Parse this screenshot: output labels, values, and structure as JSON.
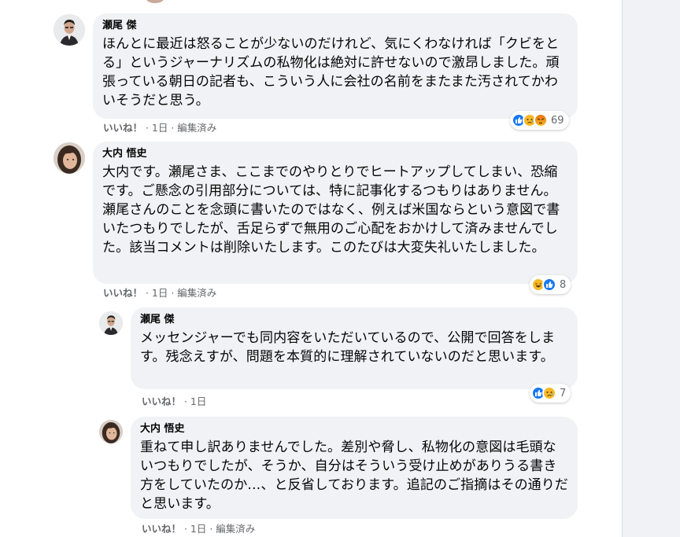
{
  "comments": [
    {
      "author": "瀬尾 傑",
      "text": "ほんとに最近は怒ることが少ないのだけれど、気にくわなければ「クビをとる」というジャーナリズムの私物化は絶対に許せないので激昂しました。頑張っている朝日の記者も、こういう人に会社の名前をまたまた汚されてかわいそうだと思う。",
      "like": "いいね！",
      "meta": " · 1日 · 編集済み",
      "reactions": [
        "like",
        "sad",
        "angry"
      ],
      "reaction_count": "69"
    },
    {
      "author": "大内 悟史",
      "text": "大内です。瀬尾さま、ここまでのやりとりでヒートアップしてしまい、恐縮です。ご懸念の引用部分については、特に記事化するつもりはありません。瀬尾さんのことを念頭に書いたのではなく、例えば米国ならという意図で書いたつもりでしたが、舌足らずで無用のご心配をおかけして済みませんでした。該当コメントは削除いたします。このたびは大変失礼いたしました。",
      "like": "いいね！",
      "meta": " · 1日 · 編集済み",
      "reactions": [
        "haha",
        "like"
      ],
      "reaction_count": "8"
    },
    {
      "author": "瀬尾 傑",
      "text": "メッセンジャーでも同内容をいただいているので、公開で回答をします。残念えすが、問題を本質的に理解されていないのだと思います。",
      "like": "いいね！",
      "meta": " · 1日",
      "reactions": [
        "like",
        "sad"
      ],
      "reaction_count": "7"
    },
    {
      "author": "大内 悟史",
      "text": "重ねて申し訳ありませんでした。差別や脅し、私物化の意図は毛頭ないつもりでしたが、そうか、自分はそういう受け止めがありうる書き方をしていたのか…、と反省しております。追記のご指摘はその通りだと思います。",
      "like": "いいね！",
      "meta": " · 1日 · 編集済み"
    }
  ],
  "colors": {
    "like_blue": "#1877f2",
    "sad_yellow": "#f7b928",
    "angry_orange": "#e9710f",
    "bubble_bg": "#f0f2f5"
  }
}
